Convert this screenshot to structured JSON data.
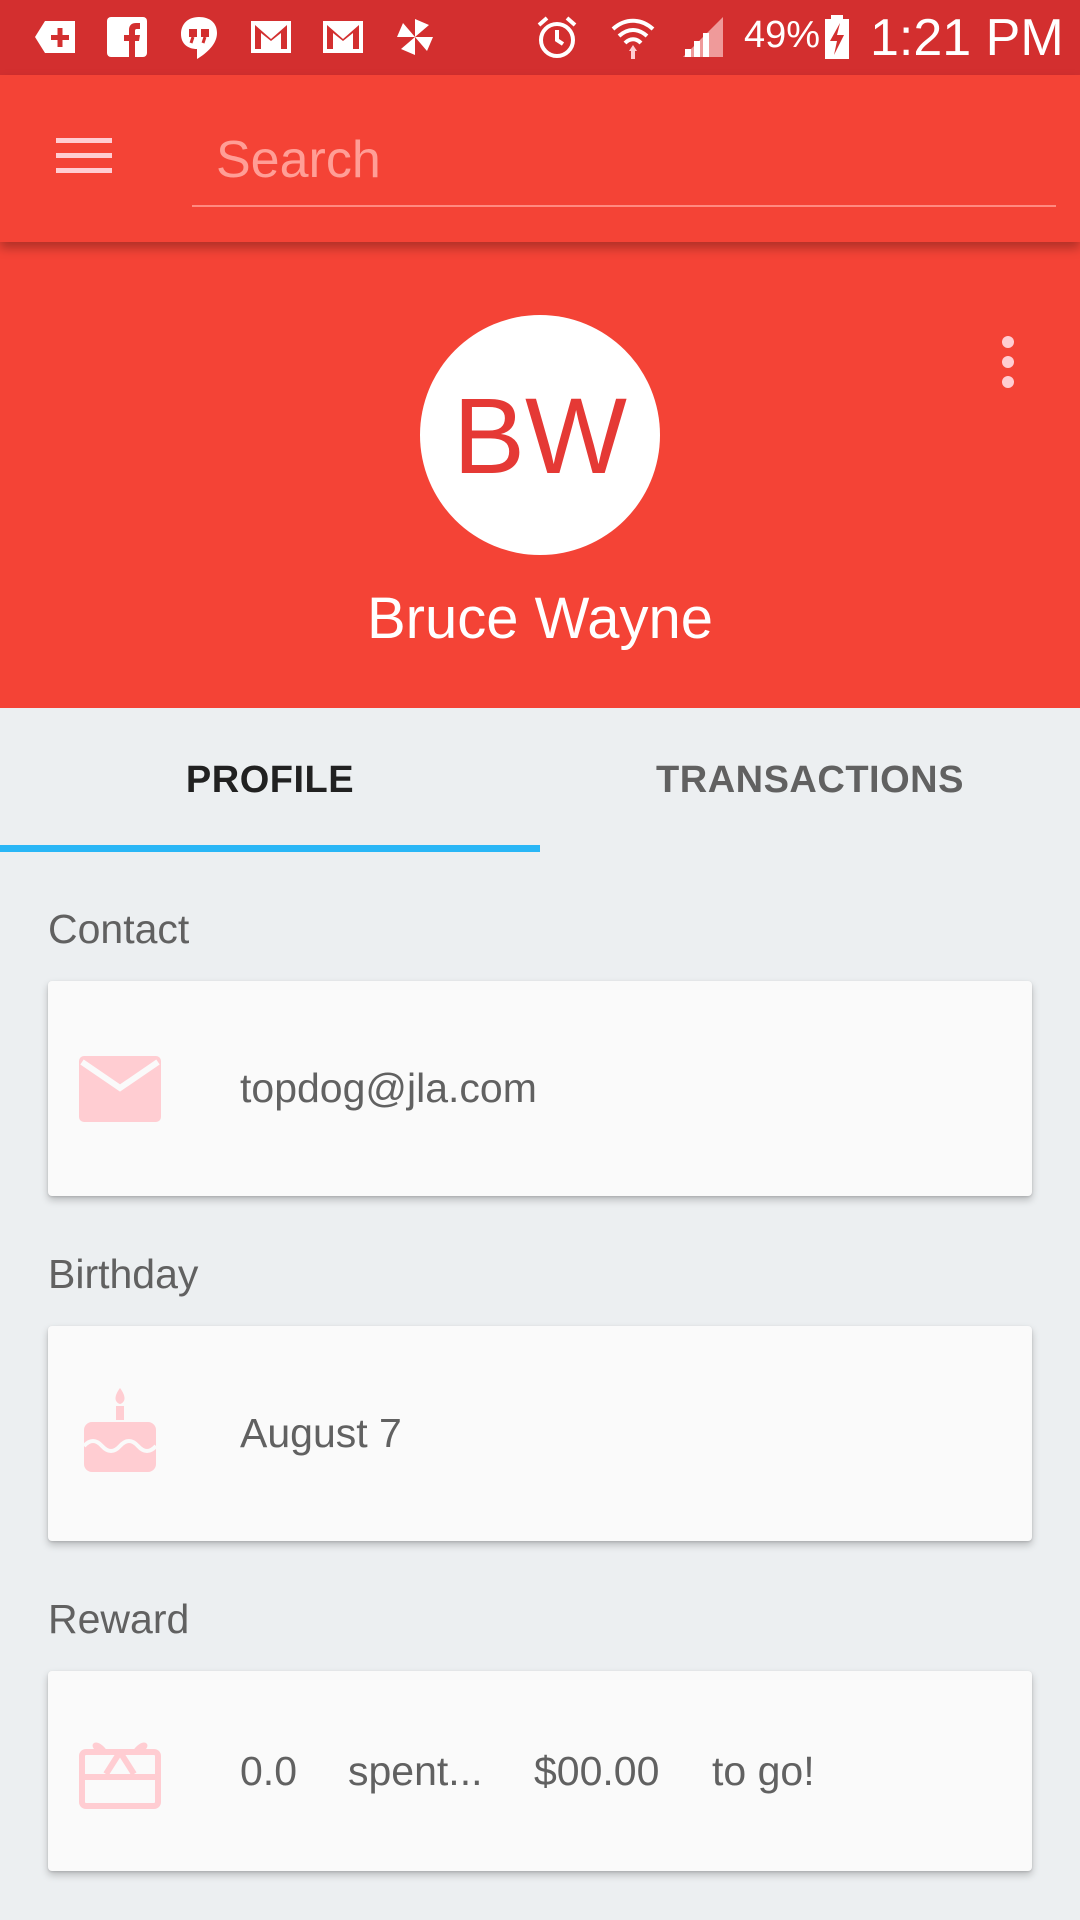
{
  "status_bar": {
    "battery_percent": "49%",
    "time": "1:21 PM",
    "icons": [
      "add-box-icon",
      "facebook-icon",
      "hangouts-icon",
      "gmail-icon",
      "gmail-icon",
      "pinwheel-icon",
      "alarm-icon",
      "wifi-icon",
      "signal-icon",
      "battery-charging-icon"
    ]
  },
  "toolbar": {
    "menu_icon": "hamburger-menu-icon",
    "search_placeholder": "Search"
  },
  "profile": {
    "initials": "BW",
    "name": "Bruce Wayne",
    "overflow_icon": "more-vert-icon"
  },
  "tabs": [
    {
      "label": "PROFILE",
      "active": true
    },
    {
      "label": "TRANSACTIONS",
      "active": false
    }
  ],
  "sections": {
    "contact": {
      "label": "Contact",
      "icon": "email-icon",
      "value": "topdog@jla.com"
    },
    "birthday": {
      "label": "Birthday",
      "icon": "cake-icon",
      "value": "August  7"
    },
    "reward": {
      "label": "Reward",
      "icon": "gift-card-icon",
      "amount": "0.0",
      "spent_text": "spent...",
      "remaining": "$00.00",
      "suffix": "to go!"
    }
  },
  "colors": {
    "status_bar": "#d32f2f",
    "primary": "#f44336",
    "tab_indicator": "#29b6f6",
    "icon_tint": "#ffcdd2",
    "background": "#eceff1",
    "card": "#fafafa"
  }
}
